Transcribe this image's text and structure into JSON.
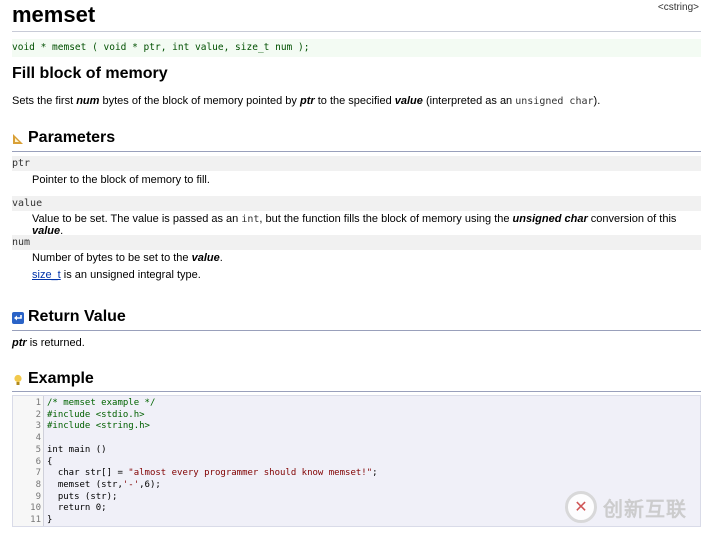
{
  "title": "memset",
  "header_tag": "<cstring>",
  "prototype": "void * memset ( void * ptr, int value, size_t num );",
  "summary": {
    "heading": "Fill block of memory",
    "parts": {
      "a": "Sets the first ",
      "num": "num",
      "b": " bytes of the block of memory pointed by ",
      "ptr": "ptr",
      "c": " to the specified ",
      "value": "value",
      "d": " (interpreted as an ",
      "code": "unsigned char",
      "e": ")."
    }
  },
  "parameters": {
    "heading": "Parameters",
    "ptr": {
      "name": "ptr",
      "desc": "Pointer to the block of memory to fill."
    },
    "value": {
      "name": "value",
      "desc_a": "Value to be set. The value is passed as an ",
      "desc_code": "int",
      "desc_b": ", but the function fills the block of memory using the ",
      "desc_em": "unsigned char",
      "desc_c": " conversion of this ",
      "desc_em2": "value",
      "desc_d": "."
    },
    "num": {
      "name": "num",
      "desc_a": "Number of bytes to be set to the ",
      "desc_em": "value",
      "desc_b": ".",
      "note_link": "size_t",
      "note_text": " is an unsigned integral type."
    }
  },
  "return_value": {
    "heading": "Return Value",
    "em": "ptr",
    "text": " is returned."
  },
  "example": {
    "heading": "Example",
    "lines": [
      {
        "n": "1",
        "text": "/* memset example */"
      },
      {
        "n": "2",
        "text": "#include <stdio.h>"
      },
      {
        "n": "3",
        "text": "#include <string.h>"
      },
      {
        "n": "4",
        "text": ""
      },
      {
        "n": "5",
        "text": "int main ()"
      },
      {
        "n": "6",
        "text": "{"
      },
      {
        "n": "7",
        "text_a": "  char str[] = ",
        "string": "\"almost every programmer should know memset!\"",
        "text_b": ";"
      },
      {
        "n": "8",
        "text_a": "  memset (str,",
        "string": "'-'",
        "text_b": ",6);"
      },
      {
        "n": "9",
        "text": "  puts (str);"
      },
      {
        "n": "10",
        "text": "  return 0;"
      },
      {
        "n": "11",
        "text": "}"
      }
    ]
  },
  "watermark": {
    "logo": "✕",
    "text": "创新互联"
  }
}
